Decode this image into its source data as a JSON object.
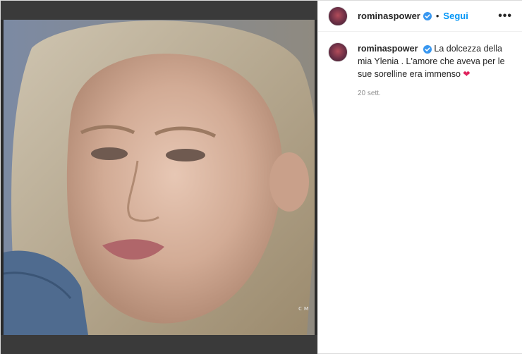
{
  "post": {
    "username": "rominaspower",
    "follow_label": "Segui",
    "separator": "•",
    "more_label": "•••",
    "caption": "La dolcezza della mia Ylenia . L'amore che aveva per le sue sorelline era immenso",
    "caption_emoji": "❤",
    "timestamp": "20 sett.",
    "verified_color": "#3897f0",
    "follow_color": "#0095f6"
  },
  "media": {
    "icon": "video-frame-girl-portrait"
  }
}
